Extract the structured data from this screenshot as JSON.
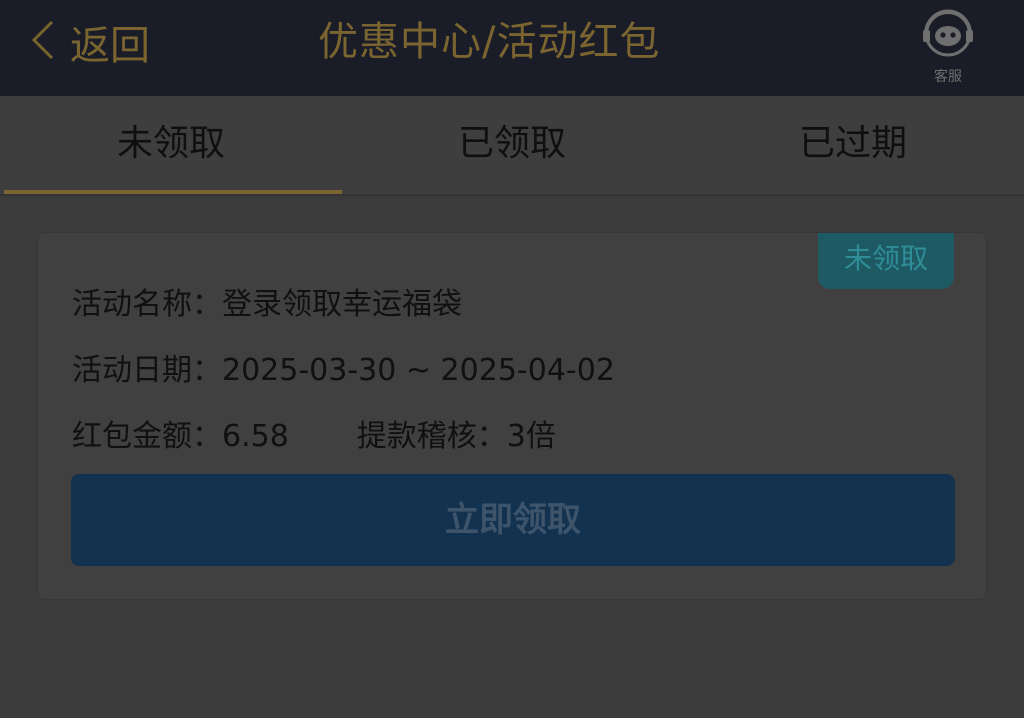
{
  "header": {
    "back_label": "返回",
    "title": "优惠中心/活动红包",
    "customer_service_label": "客服",
    "accent_color": "#7a6530"
  },
  "tabs": [
    {
      "label": "未领取",
      "active": true
    },
    {
      "label": "已领取",
      "active": false
    },
    {
      "label": "已过期",
      "active": false
    }
  ],
  "card": {
    "status_badge": "未领取",
    "activity_name_label": "活动名称：",
    "activity_name": "登录领取幸运福袋",
    "activity_date_label": "活动日期：",
    "activity_date": "2025-03-30 ~ 2025-04-02",
    "amount_label": "红包金额：",
    "amount": "6.58",
    "audit_label": "提款稽核：",
    "audit_value": "3倍",
    "claim_button": "立即领取",
    "badge_color": "#1e5a64",
    "button_color": "#12324f"
  },
  "icons": {
    "back": "chevron-left-icon",
    "customer_service": "headset-robot-icon"
  }
}
